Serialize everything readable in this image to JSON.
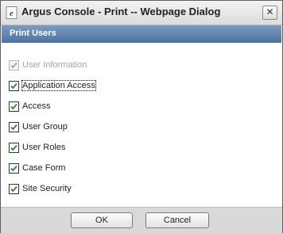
{
  "window": {
    "title": "Argus Console - Print -- Webpage Dialog",
    "close_glyph": "✕"
  },
  "header": {
    "title": "Print Users"
  },
  "options": [
    {
      "label": "User Information",
      "checked": true,
      "disabled": true
    },
    {
      "label": "Application Access",
      "checked": true,
      "disabled": false,
      "focused": true
    },
    {
      "label": "Access",
      "checked": true,
      "disabled": false
    },
    {
      "label": "User Group",
      "checked": true,
      "disabled": false
    },
    {
      "label": "User Roles",
      "checked": true,
      "disabled": false
    },
    {
      "label": "Case Form",
      "checked": true,
      "disabled": false
    },
    {
      "label": "Site Security",
      "checked": true,
      "disabled": false
    }
  ],
  "buttons": {
    "ok": "OK",
    "cancel": "Cancel"
  },
  "colors": {
    "header": "#5a7caa",
    "check": "#2d8a1f",
    "footer": "#d9d9d9"
  },
  "icons": {
    "window": "ie-page-icon",
    "close": "close-icon",
    "check": "checkmark-icon"
  }
}
